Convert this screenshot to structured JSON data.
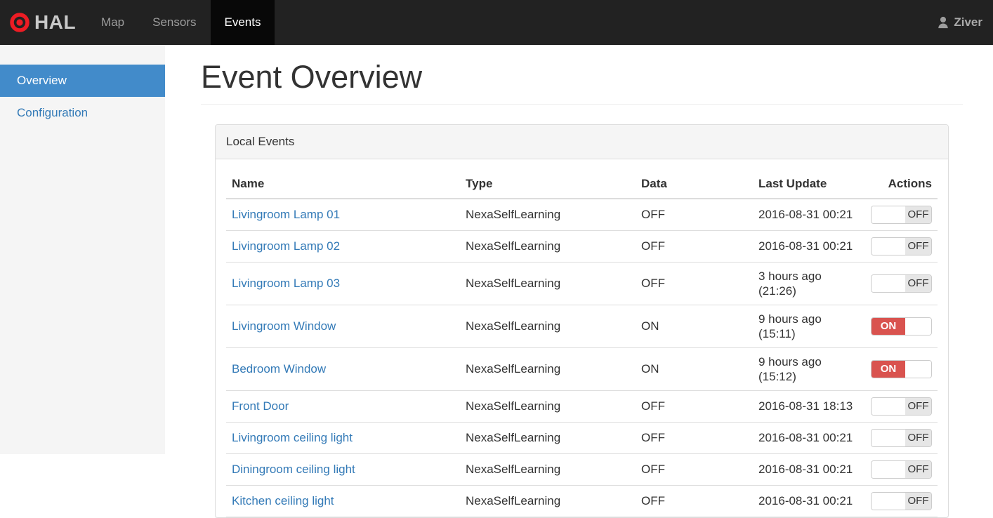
{
  "navbar": {
    "brand": "HAL",
    "items": [
      {
        "label": "Map",
        "active": false
      },
      {
        "label": "Sensors",
        "active": false
      },
      {
        "label": "Events",
        "active": true
      }
    ],
    "user": "Ziver"
  },
  "sidebar": {
    "items": [
      {
        "label": "Overview",
        "active": true
      },
      {
        "label": "Configuration",
        "active": false
      }
    ]
  },
  "main": {
    "title": "Event Overview",
    "panel": {
      "title": "Local Events",
      "table": {
        "columns": [
          "Name",
          "Type",
          "Data",
          "Last Update",
          "Actions"
        ],
        "rows": [
          {
            "name": "Livingroom Lamp 01",
            "type": "NexaSelfLearning",
            "data": "OFF",
            "last_update": "2016-08-31 00:21",
            "toggle": "OFF"
          },
          {
            "name": "Livingroom Lamp 02",
            "type": "NexaSelfLearning",
            "data": "OFF",
            "last_update": "2016-08-31 00:21",
            "toggle": "OFF"
          },
          {
            "name": "Livingroom Lamp 03",
            "type": "NexaSelfLearning",
            "data": "OFF",
            "last_update": "3 hours ago (21:26)",
            "toggle": "OFF"
          },
          {
            "name": "Livingroom Window",
            "type": "NexaSelfLearning",
            "data": "ON",
            "last_update": "9 hours ago (15:11)",
            "toggle": "ON"
          },
          {
            "name": "Bedroom Window",
            "type": "NexaSelfLearning",
            "data": "ON",
            "last_update": "9 hours ago (15:12)",
            "toggle": "ON"
          },
          {
            "name": "Front Door",
            "type": "NexaSelfLearning",
            "data": "OFF",
            "last_update": "2016-08-31 18:13",
            "toggle": "OFF"
          },
          {
            "name": "Livingroom ceiling light",
            "type": "NexaSelfLearning",
            "data": "OFF",
            "last_update": "2016-08-31 00:21",
            "toggle": "OFF"
          },
          {
            "name": "Diningroom ceiling light",
            "type": "NexaSelfLearning",
            "data": "OFF",
            "last_update": "2016-08-31 00:21",
            "toggle": "OFF"
          },
          {
            "name": "Kitchen ceiling light",
            "type": "NexaSelfLearning",
            "data": "OFF",
            "last_update": "2016-08-31 00:21",
            "toggle": "OFF"
          }
        ]
      }
    }
  },
  "colors": {
    "navbar_bg": "#222222",
    "active_tab_bg": "#080808",
    "logo_red": "#ed1c24",
    "sidebar_active_blue": "#428bca",
    "link_blue": "#337ab7",
    "toggle_on_red": "#d9534f",
    "toggle_off_gray": "#e6e6e6"
  }
}
